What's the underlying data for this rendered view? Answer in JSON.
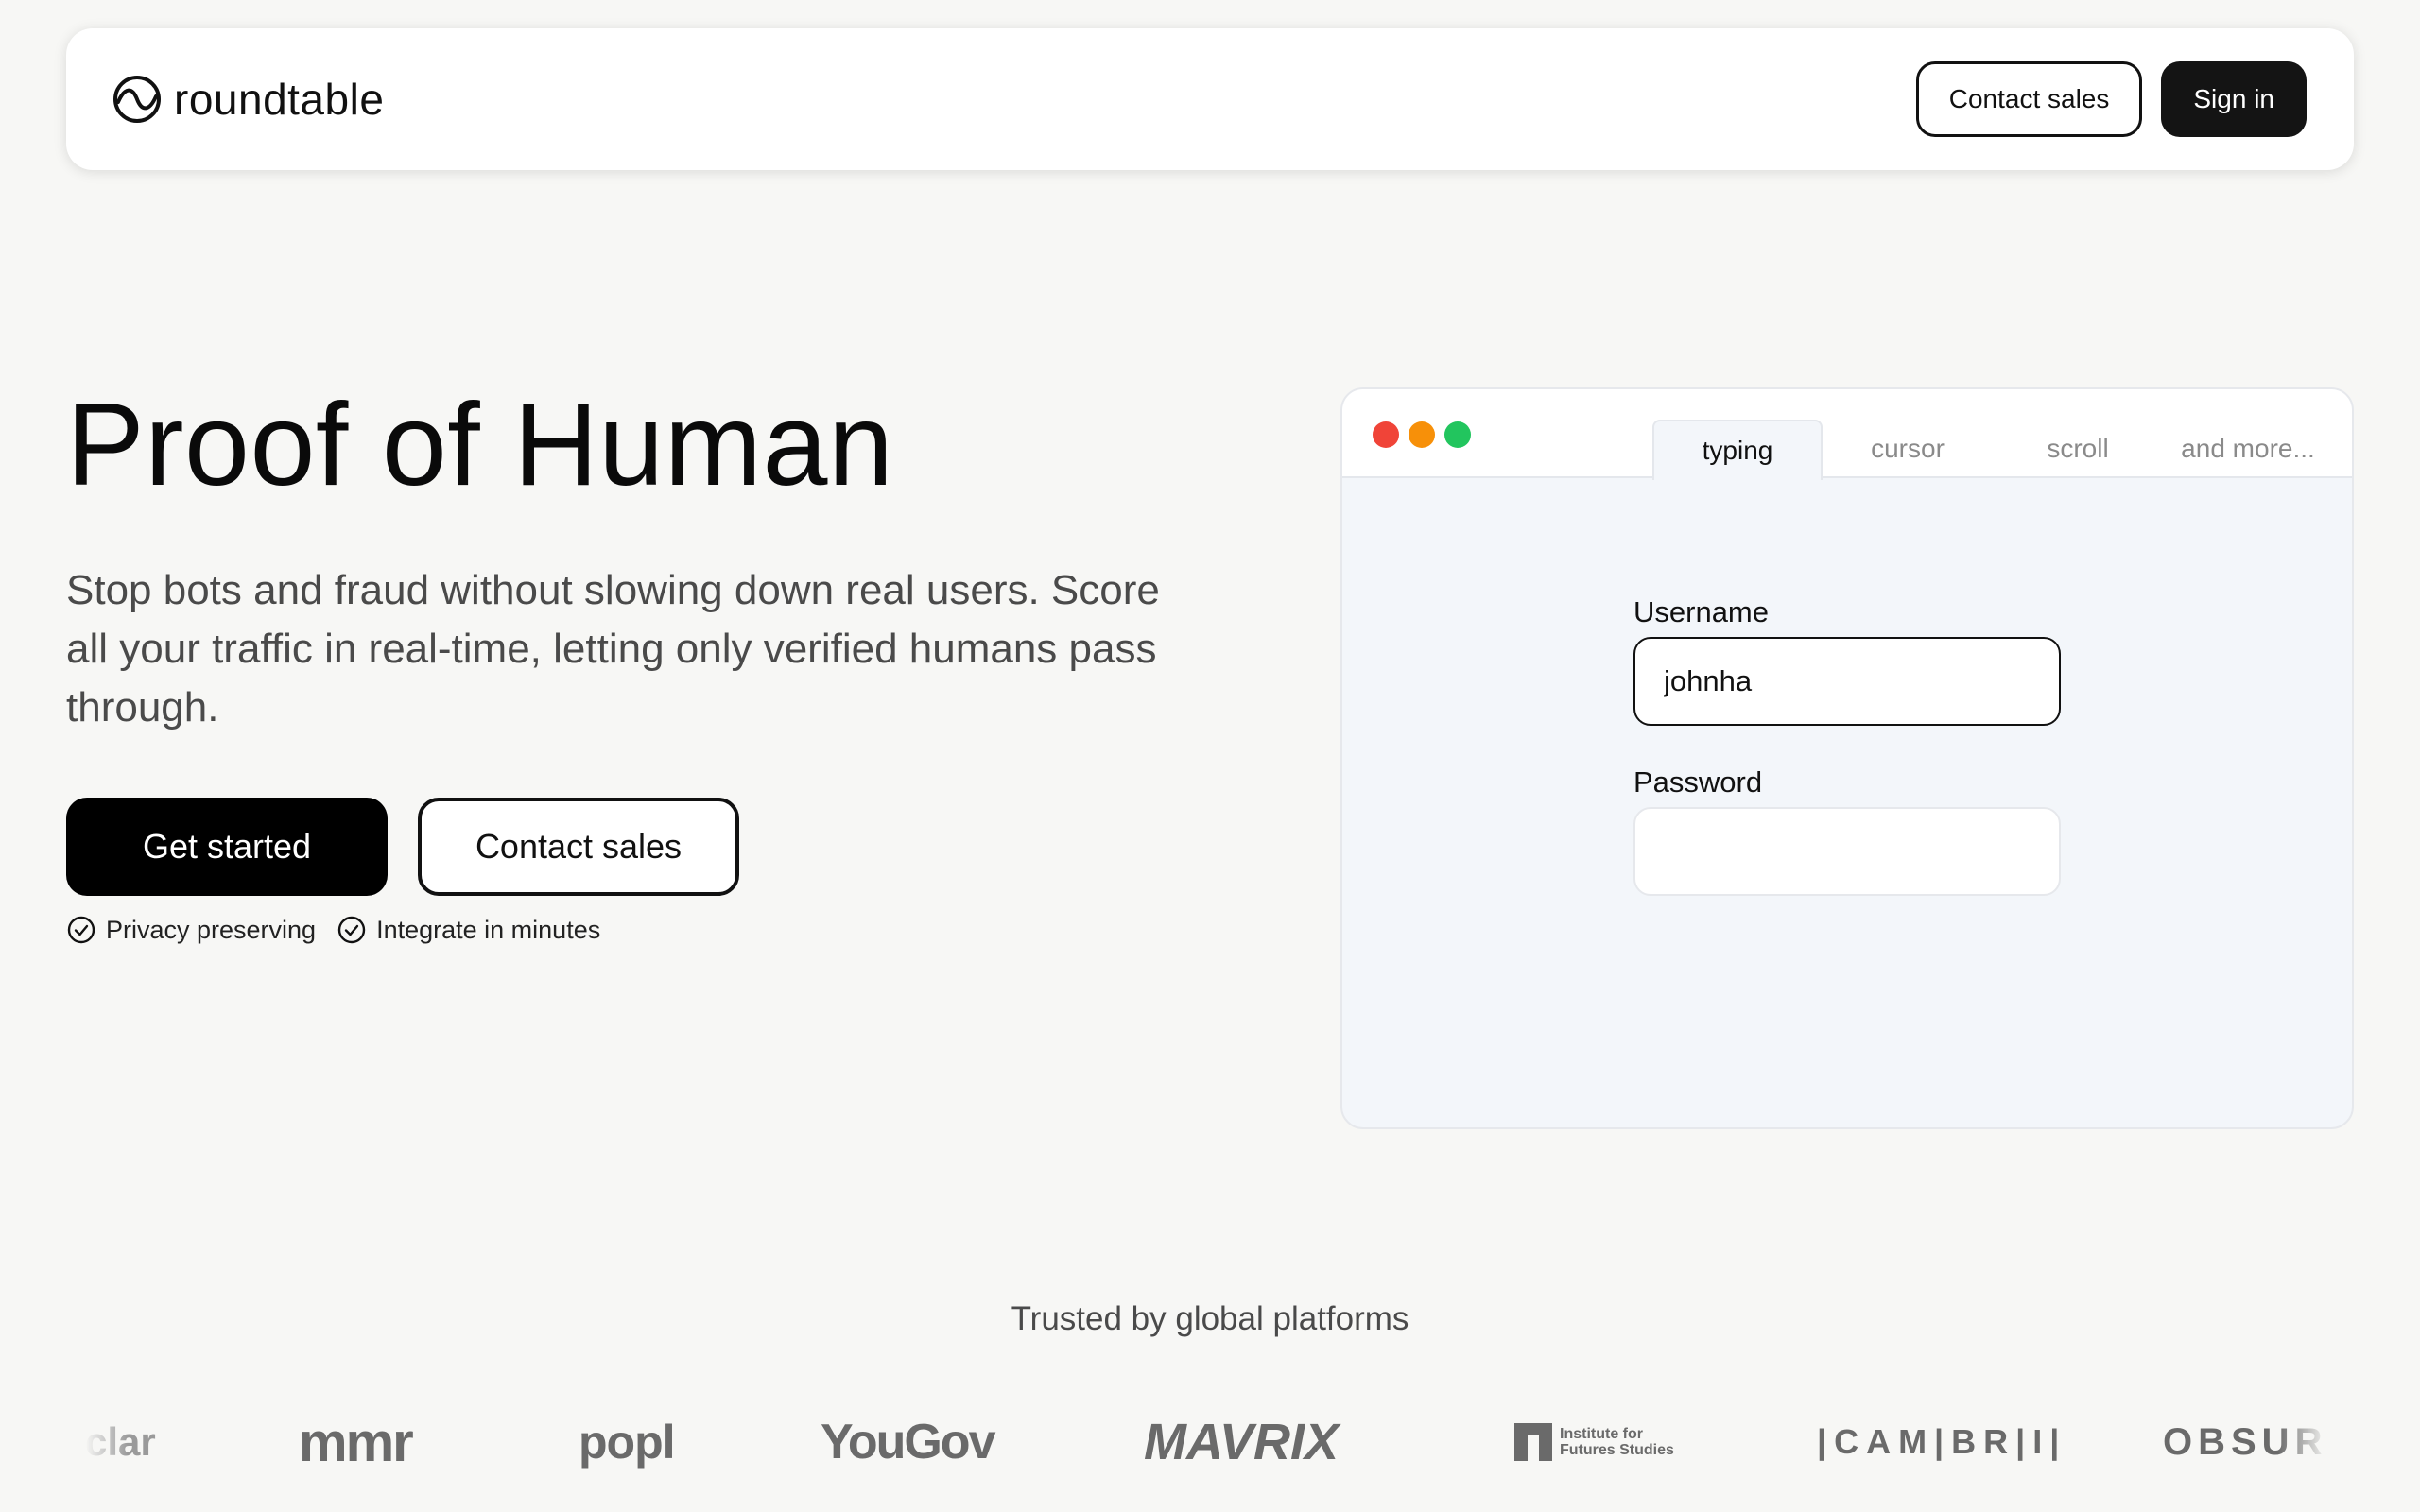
{
  "nav": {
    "brand": "roundtable",
    "contact_sales": "Contact sales",
    "sign_in": "Sign in"
  },
  "hero": {
    "title": "Proof of Human",
    "subtitle": "Stop bots and fraud without slowing down real users. Score all your traffic in real-time, letting only verified humans pass through.",
    "get_started": "Get started",
    "contact_sales": "Contact sales",
    "features": [
      "Privacy preserving",
      "Integrate in minutes"
    ]
  },
  "demo": {
    "dot_colors": [
      "#f04438",
      "#f79009",
      "#22c55e"
    ],
    "tabs": [
      {
        "label": "typing",
        "active": true
      },
      {
        "label": "cursor",
        "active": false
      },
      {
        "label": "scroll",
        "active": false
      },
      {
        "label": "and more...",
        "active": false
      }
    ],
    "username_label": "Username",
    "username_value": "johnha",
    "password_label": "Password",
    "password_value": ""
  },
  "trusted": {
    "title": "Trusted by global platforms",
    "logos": {
      "clar": "clar",
      "mmr": "mmr",
      "popl": "popl",
      "yougov": "YouGov",
      "mavrix": "MAVRIX",
      "iffs_line1": "Institute for",
      "iffs_line2": "Futures Studies",
      "cambri": "|CAM|BR|I|",
      "obsur": "OBSUR"
    }
  }
}
